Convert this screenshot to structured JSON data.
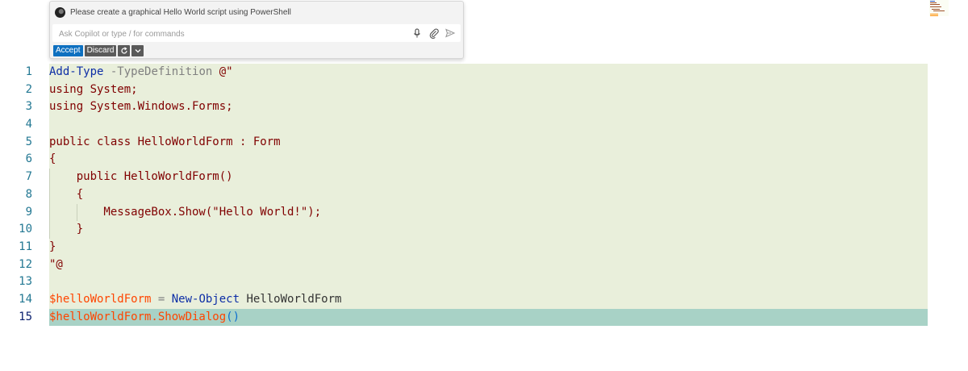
{
  "chat": {
    "prompt": "Please create a graphical Hello World script using PowerShell",
    "input_placeholder": "Ask Copilot or type / for commands",
    "accept_label": "Accept",
    "discard_label": "Discard",
    "icons": [
      "microphone-icon",
      "attach-icon",
      "send-icon",
      "regenerate-icon",
      "chevron-down-icon"
    ]
  },
  "editor": {
    "lines": [
      {
        "n": "1",
        "tokens": [
          {
            "t": "Add-Type",
            "c": "cmd"
          },
          {
            "t": " ",
            "c": "plain"
          },
          {
            "t": "-TypeDefinition",
            "c": "param"
          },
          {
            "t": " @\"",
            "c": "str"
          }
        ]
      },
      {
        "n": "2",
        "tokens": [
          {
            "t": "using System;",
            "c": "str"
          }
        ]
      },
      {
        "n": "3",
        "tokens": [
          {
            "t": "using System.Windows.Forms;",
            "c": "str"
          }
        ]
      },
      {
        "n": "4",
        "tokens": []
      },
      {
        "n": "5",
        "tokens": [
          {
            "t": "public class HelloWorldForm : Form",
            "c": "str"
          }
        ]
      },
      {
        "n": "6",
        "tokens": [
          {
            "t": "{",
            "c": "str"
          }
        ]
      },
      {
        "n": "7",
        "tokens": [
          {
            "t": "    public HelloWorldForm()",
            "c": "str"
          }
        ]
      },
      {
        "n": "8",
        "tokens": [
          {
            "t": "    {",
            "c": "str"
          }
        ]
      },
      {
        "n": "9",
        "tokens": [
          {
            "t": "        MessageBox.Show(\"Hello World!\");",
            "c": "str"
          }
        ]
      },
      {
        "n": "10",
        "tokens": [
          {
            "t": "    }",
            "c": "str"
          }
        ]
      },
      {
        "n": "11",
        "tokens": [
          {
            "t": "}",
            "c": "str"
          }
        ]
      },
      {
        "n": "12",
        "tokens": [
          {
            "t": "\"@",
            "c": "str"
          }
        ]
      },
      {
        "n": "13",
        "tokens": []
      },
      {
        "n": "14",
        "tokens": [
          {
            "t": "$helloWorldForm",
            "c": "var"
          },
          {
            "t": " = ",
            "c": "param"
          },
          {
            "t": "New-Object",
            "c": "cmd"
          },
          {
            "t": " HelloWorldForm",
            "c": "plain"
          }
        ]
      },
      {
        "n": "15",
        "tokens": [
          {
            "t": "$helloWorldForm.ShowDialog",
            "c": "var"
          },
          {
            "t": "()",
            "c": "blue"
          }
        ],
        "active": true
      }
    ]
  }
}
